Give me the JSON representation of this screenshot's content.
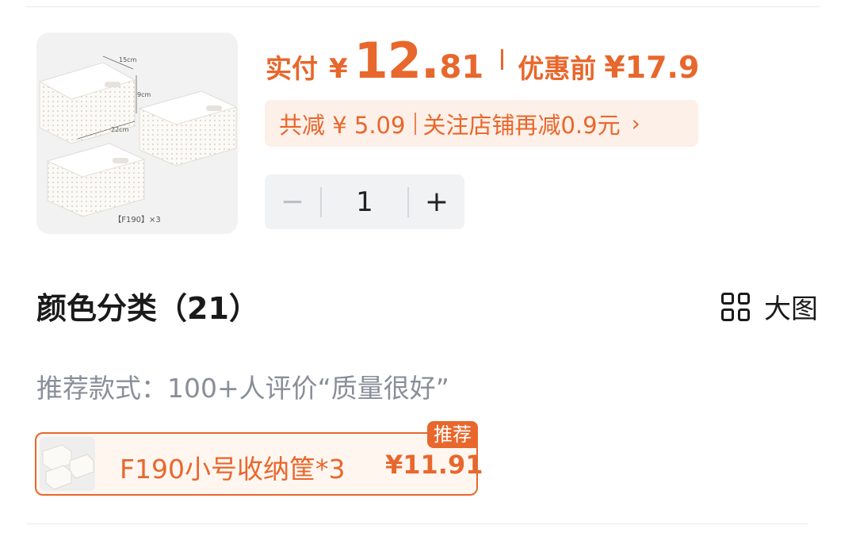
{
  "product": {
    "image_caption": "【F190】×3",
    "dim_width": "15cm",
    "dim_height": "9cm",
    "dim_length": "22cm"
  },
  "price": {
    "paid_label": "实付",
    "currency": "¥",
    "paid_int": "12",
    "paid_dot": ".",
    "paid_dec": "81",
    "original_label": "优惠前",
    "original_price": "¥17.9"
  },
  "discount": {
    "saved_text": "共减 ¥ 5.09",
    "follow_text": "关注店铺再减0.9元",
    "chevron": "›"
  },
  "quantity": {
    "minus": "−",
    "value": "1",
    "plus": "+"
  },
  "colors": {
    "title": "颜色分类（21）",
    "big_image_label": "大图",
    "recommend_text": "推荐款式：100+人评价“质量很好”",
    "variants": [
      {
        "name": "F190小号收纳筐*3",
        "price": "¥11.91",
        "badge": "推荐",
        "selected": true
      }
    ]
  },
  "theme": {
    "accent": "#e8672c",
    "accent_bg": "#fdf0e8",
    "muted_text": "#8a8e99"
  },
  "icons": [
    "grid-icon",
    "chevron-right-icon"
  ]
}
